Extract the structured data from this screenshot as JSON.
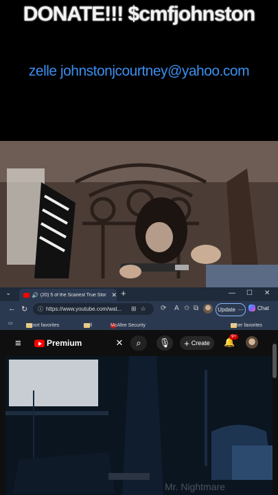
{
  "overlay": {
    "donate_text": "DONATE!!! $cmfjohnston",
    "zelle_text": "zelle johnstonjcourtney@yahoo.com"
  },
  "browser": {
    "tab": {
      "title": "(20) 5 of the Scariest True Stor",
      "close": "✕"
    },
    "new_tab": "+",
    "window_controls": {
      "minimize": "—",
      "maximize": "☐",
      "close": "✕"
    },
    "address": {
      "url": "https://www.youtube.com/wat...",
      "back": "←",
      "refresh": "↻"
    },
    "update_label": "Update",
    "chat_label": "Chat",
    "favorites": {
      "import": "Import favorites",
      "dell": "Dell",
      "mcafee": "McAfee Security",
      "other": "Other favorites"
    }
  },
  "youtube": {
    "logo_label": "Premium",
    "create_label": "Create",
    "notification_count": "9+",
    "watermark": "Mr. Nightmare"
  },
  "colors": {
    "zelle_blue": "#3a8ff0",
    "youtube_red": "#ff0000",
    "edge_tab_bar": "#1f2a3a"
  }
}
